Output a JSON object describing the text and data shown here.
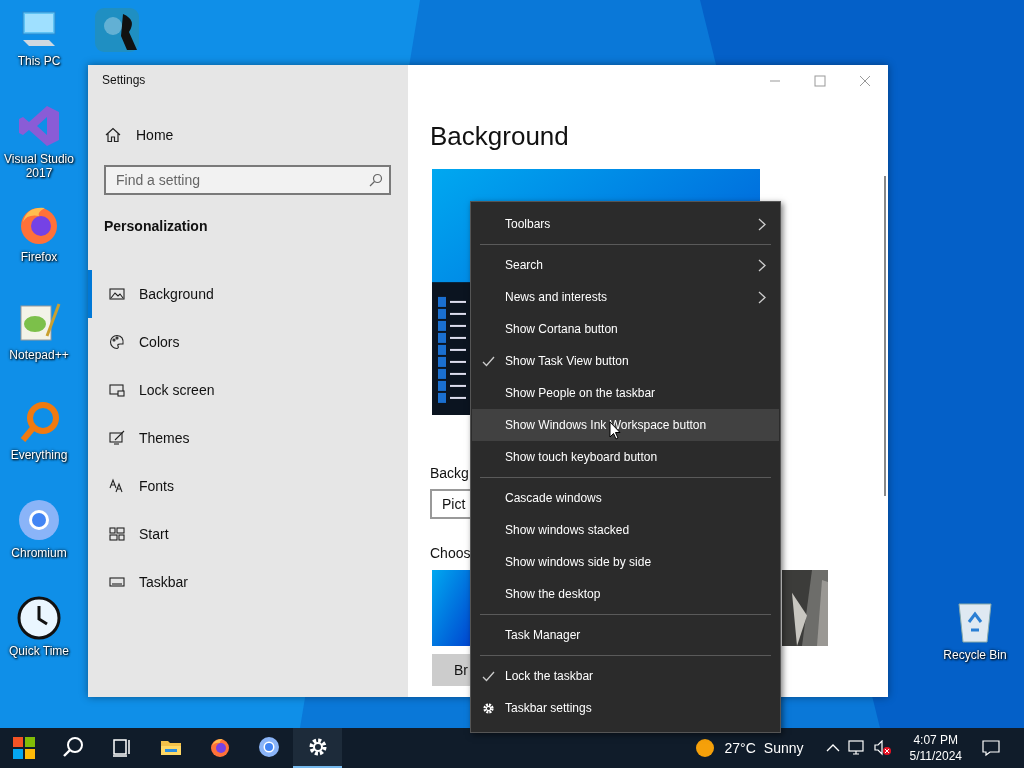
{
  "desktop_icons": [
    {
      "label": "This PC",
      "kind": "pc"
    },
    {
      "kind": "sm"
    },
    {
      "label": "Visual Studio 2017",
      "kind": "vs"
    },
    {
      "label": "Firefox",
      "kind": "firefox"
    },
    {
      "label": "Notepad++",
      "kind": "notepad"
    },
    {
      "label": "Everything",
      "kind": "everything"
    },
    {
      "label": "Chromium",
      "kind": "chromium"
    },
    {
      "label": "Quick Time",
      "kind": "clock"
    },
    {
      "label": "Recycle Bin",
      "kind": "recycle"
    }
  ],
  "settings_window": {
    "title": "Settings",
    "home": "Home",
    "search": {
      "placeholder": "Find a setting"
    },
    "section": "Personalization",
    "nav": [
      {
        "label": "Background",
        "kind": "picture-nav",
        "selected": true
      },
      {
        "label": "Colors",
        "kind": "palette",
        "selected": false
      },
      {
        "label": "Lock screen",
        "kind": "lock",
        "selected": false
      },
      {
        "label": "Themes",
        "kind": "themes",
        "selected": false
      },
      {
        "label": "Fonts",
        "kind": "fonts",
        "selected": false
      },
      {
        "label": "Start",
        "kind": "start",
        "selected": false
      },
      {
        "label": "Taskbar",
        "kind": "taskbar",
        "selected": false
      }
    ],
    "page": {
      "heading": "Background",
      "background_label": "Backg",
      "background_value": "Pict",
      "choose_label": "Choos",
      "browse_button": "Br"
    }
  },
  "context_menu": [
    {
      "kind": "item",
      "label": "Toolbars",
      "checked": false,
      "submenu": true,
      "highlighted": false
    },
    {
      "kind": "separator"
    },
    {
      "kind": "item",
      "label": "Search",
      "checked": false,
      "submenu": true,
      "highlighted": false
    },
    {
      "kind": "item",
      "label": "News and interests",
      "checked": false,
      "submenu": true,
      "highlighted": false
    },
    {
      "kind": "item",
      "label": "Show Cortana button",
      "checked": false,
      "submenu": false,
      "highlighted": false
    },
    {
      "kind": "item",
      "label": "Show Task View button",
      "checked": true,
      "submenu": false,
      "highlighted": false
    },
    {
      "kind": "item",
      "label": "Show People on the taskbar",
      "checked": false,
      "submenu": false,
      "highlighted": false
    },
    {
      "kind": "item",
      "label": "Show Windows Ink Workspace button",
      "checked": false,
      "submenu": false,
      "highlighted": true
    },
    {
      "kind": "item",
      "label": "Show touch keyboard button",
      "checked": false,
      "submenu": false,
      "highlighted": false
    },
    {
      "kind": "separator"
    },
    {
      "kind": "item",
      "label": "Cascade windows",
      "checked": false,
      "submenu": false,
      "highlighted": false
    },
    {
      "kind": "item",
      "label": "Show windows stacked",
      "checked": false,
      "submenu": false,
      "highlighted": false
    },
    {
      "kind": "item",
      "label": "Show windows side by side",
      "checked": false,
      "submenu": false,
      "highlighted": false
    },
    {
      "kind": "item",
      "label": "Show the desktop",
      "checked": false,
      "submenu": false,
      "highlighted": false
    },
    {
      "kind": "separator"
    },
    {
      "kind": "item",
      "label": "Task Manager",
      "checked": false,
      "submenu": false,
      "highlighted": false
    },
    {
      "kind": "separator"
    },
    {
      "kind": "item",
      "label": "Lock the taskbar",
      "checked": true,
      "submenu": false,
      "highlighted": false
    },
    {
      "kind": "settings",
      "label": "Taskbar settings",
      "submenu": false,
      "highlighted": false
    }
  ],
  "taskbar": {
    "apps": [
      {
        "kind": "search",
        "selected": false
      },
      {
        "kind": "taskview",
        "selected": false
      },
      {
        "kind": "folder",
        "selected": false
      },
      {
        "kind": "firefox",
        "selected": false
      },
      {
        "kind": "chromium",
        "selected": false
      },
      {
        "kind": "gear",
        "selected": true
      }
    ],
    "weather": {
      "temperature": "27°C",
      "condition": "Sunny"
    },
    "time": "4:07 PM",
    "date": "5/11/2024"
  }
}
